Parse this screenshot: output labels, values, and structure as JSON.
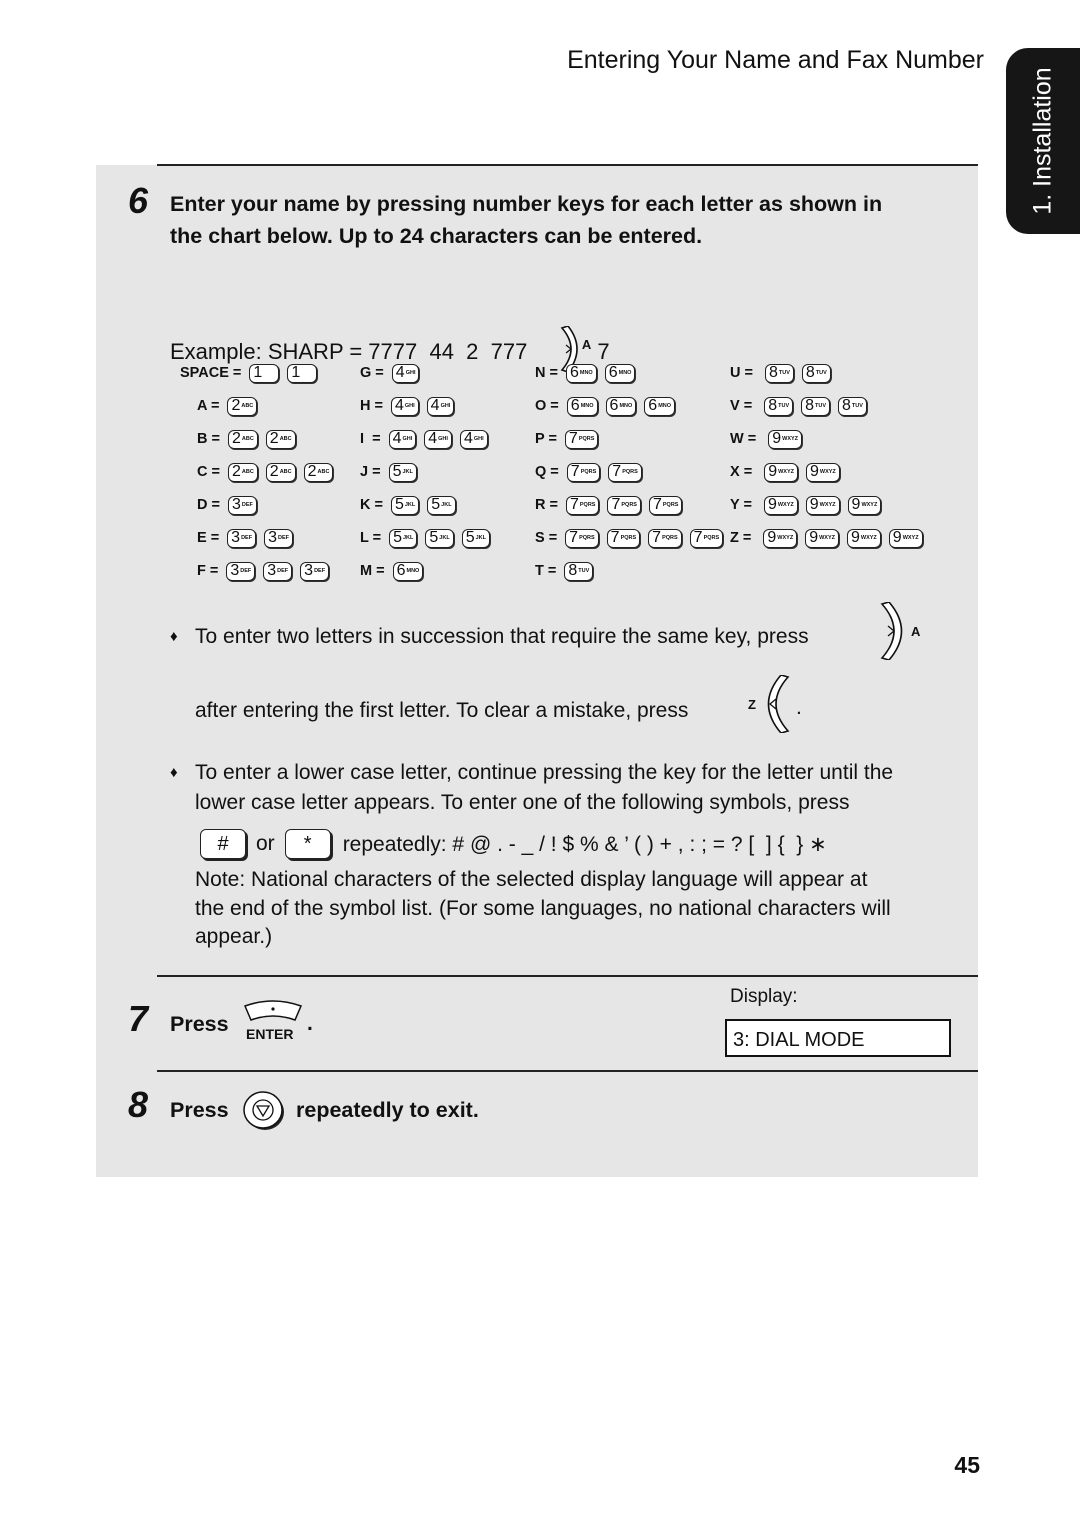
{
  "header": {
    "title": "Entering Your Name and Fax Number"
  },
  "side_tab": {
    "label": "1. Installation"
  },
  "step6": {
    "number": "6",
    "text_line1": "Enter your name by pressing number keys for each letter as shown in",
    "text_line2": "the chart below. Up to 24 characters can be entered.",
    "example_prefix": "Example: SHARP = 7777  44  2  777 ",
    "example_key_letter": "A",
    "example_suffix": " 7"
  },
  "chart": {
    "columns": [
      [
        {
          "label": "SPACE =",
          "keys": [
            [
              "1",
              ""
            ],
            [
              "1",
              ""
            ]
          ]
        },
        {
          "label": "A =",
          "keys": [
            [
              "2",
              "ABC"
            ]
          ]
        },
        {
          "label": "B =",
          "keys": [
            [
              "2",
              "ABC"
            ],
            [
              "2",
              "ABC"
            ]
          ]
        },
        {
          "label": "C =",
          "keys": [
            [
              "2",
              "ABC"
            ],
            [
              "2",
              "ABC"
            ],
            [
              "2",
              "ABC"
            ]
          ]
        },
        {
          "label": "D =",
          "keys": [
            [
              "3",
              "DEF"
            ]
          ]
        },
        {
          "label": "E =",
          "keys": [
            [
              "3",
              "DEF"
            ],
            [
              "3",
              "DEF"
            ]
          ]
        },
        {
          "label": "F =",
          "keys": [
            [
              "3",
              "DEF"
            ],
            [
              "3",
              "DEF"
            ],
            [
              "3",
              "DEF"
            ]
          ]
        }
      ],
      [
        {
          "label": "G =",
          "keys": [
            [
              "4",
              "GHI"
            ]
          ]
        },
        {
          "label": "H =",
          "keys": [
            [
              "4",
              "GHI"
            ],
            [
              "4",
              "GHI"
            ]
          ]
        },
        {
          "label": "I  =",
          "keys": [
            [
              "4",
              "GHI"
            ],
            [
              "4",
              "GHI"
            ],
            [
              "4",
              "GHI"
            ]
          ]
        },
        {
          "label": "J =",
          "keys": [
            [
              "5",
              "JKL"
            ]
          ]
        },
        {
          "label": "K =",
          "keys": [
            [
              "5",
              "JKL"
            ],
            [
              "5",
              "JKL"
            ]
          ]
        },
        {
          "label": "L =",
          "keys": [
            [
              "5",
              "JKL"
            ],
            [
              "5",
              "JKL"
            ],
            [
              "5",
              "JKL"
            ]
          ]
        },
        {
          "label": "M =",
          "keys": [
            [
              "6",
              "MNO"
            ]
          ]
        }
      ],
      [
        {
          "label": "N =",
          "keys": [
            [
              "6",
              "MNO"
            ],
            [
              "6",
              "MNO"
            ]
          ]
        },
        {
          "label": "O =",
          "keys": [
            [
              "6",
              "MNO"
            ],
            [
              "6",
              "MNO"
            ],
            [
              "6",
              "MNO"
            ]
          ]
        },
        {
          "label": "P =",
          "keys": [
            [
              "7",
              "PQRS"
            ]
          ]
        },
        {
          "label": "Q =",
          "keys": [
            [
              "7",
              "PQRS"
            ],
            [
              "7",
              "PQRS"
            ]
          ]
        },
        {
          "label": "R =",
          "keys": [
            [
              "7",
              "PQRS"
            ],
            [
              "7",
              "PQRS"
            ],
            [
              "7",
              "PQRS"
            ]
          ]
        },
        {
          "label": "S =",
          "keys": [
            [
              "7",
              "PQRS"
            ],
            [
              "7",
              "PQRS"
            ],
            [
              "7",
              "PQRS"
            ],
            [
              "7",
              "PQRS"
            ]
          ]
        },
        {
          "label": "T =",
          "keys": [
            [
              "8",
              "TUV"
            ]
          ]
        }
      ],
      [
        {
          "label": "U = ",
          "keys": [
            [
              "8",
              "TUV"
            ],
            [
              "8",
              "TUV"
            ]
          ]
        },
        {
          "label": "V = ",
          "keys": [
            [
              "8",
              "TUV"
            ],
            [
              "8",
              "TUV"
            ],
            [
              "8",
              "TUV"
            ]
          ]
        },
        {
          "label": "W = ",
          "keys": [
            [
              "9",
              "WXYZ"
            ]
          ]
        },
        {
          "label": "X = ",
          "keys": [
            [
              "9",
              "WXYZ"
            ],
            [
              "9",
              "WXYZ"
            ]
          ]
        },
        {
          "label": "Y = ",
          "keys": [
            [
              "9",
              "WXYZ"
            ],
            [
              "9",
              "WXYZ"
            ],
            [
              "9",
              "WXYZ"
            ]
          ]
        },
        {
          "label": "Z = ",
          "keys": [
            [
              "9",
              "WXYZ"
            ],
            [
              "9",
              "WXYZ"
            ],
            [
              "9",
              "WXYZ"
            ],
            [
              "9",
              "WXYZ"
            ]
          ]
        }
      ]
    ]
  },
  "bullets": {
    "b1_line1": "To enter two letters in succession that require the same key, press",
    "b1_key_letter": "A",
    "b1_line2": "after entering the first letter. To clear a mistake, press",
    "b1_clear_key_letter": "Z",
    "b2_line1": "To enter a lower case letter, continue pressing the key for the letter until the",
    "b2_line2": "lower case letter appears. To enter one of the following symbols, press",
    "hash_key": "#",
    "or": "or",
    "star_key": "*",
    "symbols": "repeatedly: # @ . - _ / ! $ % & ’ ( ) + , : ; = ? [  ] {  } ∗",
    "note_line1": "Note: National characters of the selected display language will appear at",
    "note_line2": "the end of the symbol list. (For some languages, no national characters will",
    "note_line3": "appear.)"
  },
  "step7": {
    "number": "7",
    "press": "Press",
    "enter_label": "ENTER",
    "period": ".",
    "display_label": "Display:",
    "display_value": "3: DIAL MODE"
  },
  "step8": {
    "number": "8",
    "press": "Press",
    "rest": "repeatedly to exit."
  },
  "page_number": "45"
}
